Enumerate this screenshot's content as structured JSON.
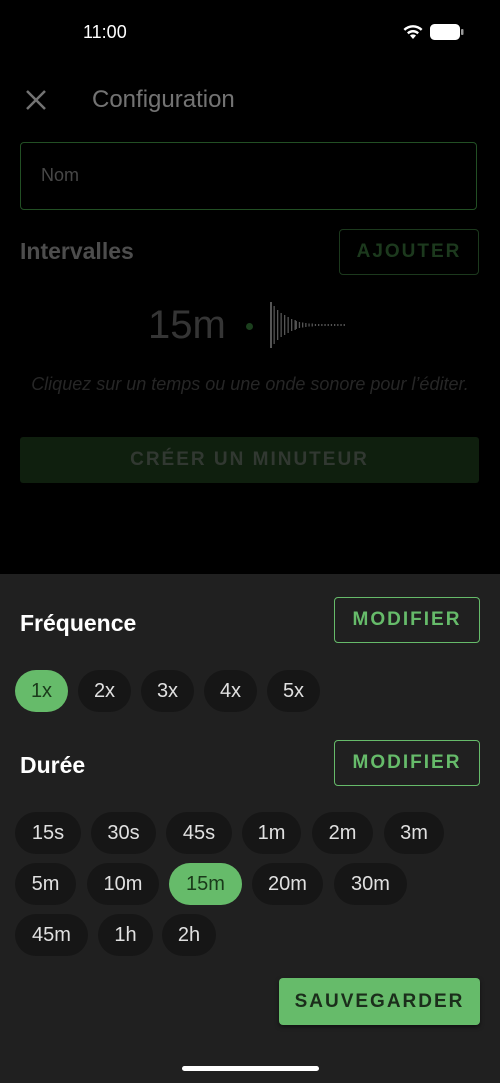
{
  "status": {
    "time": "11:00"
  },
  "header": {
    "title": "Configuration"
  },
  "name_field": {
    "placeholder": "Nom"
  },
  "intervals": {
    "label": "Intervalles",
    "add_label": "AJOUTER",
    "time": "15m",
    "hint": "Cliquez sur un temps ou une onde sonore pour l’éditer.",
    "create_label": "CRÉER UN MINUTEUR"
  },
  "frequency": {
    "label": "Fréquence",
    "modify_label": "MODIFIER",
    "options": [
      "1x",
      "2x",
      "3x",
      "4x",
      "5x"
    ],
    "selected": "1x"
  },
  "duration": {
    "label": "Durée",
    "modify_label": "MODIFIER",
    "options": [
      "15s",
      "30s",
      "45s",
      "1m",
      "2m",
      "3m",
      "5m",
      "10m",
      "15m",
      "20m",
      "30m",
      "45m",
      "1h",
      "2h"
    ],
    "selected": "15m"
  },
  "save_label": "SAUVEGARDER",
  "colors": {
    "accent": "#66bb6a",
    "sheet": "#202020",
    "chip": "#161616"
  }
}
